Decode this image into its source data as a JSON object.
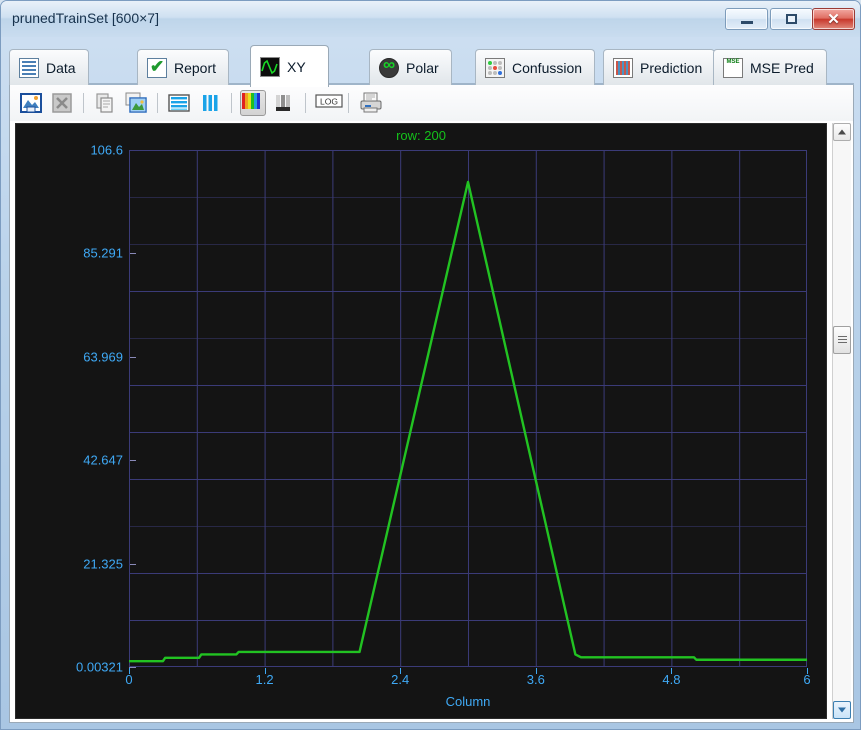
{
  "window": {
    "title": "prunedTrainSet [600×7]",
    "minimize_label": "Minimize",
    "maximize_label": "Restore",
    "close_label": "✕"
  },
  "tabs": [
    {
      "label": "Data",
      "icon": "table-icon",
      "active": false
    },
    {
      "label": "Report",
      "icon": "checkmark-icon",
      "active": false
    },
    {
      "label": "XY",
      "icon": "waveform-icon",
      "active": true
    },
    {
      "label": "Polar",
      "icon": "polar-icon",
      "active": false
    },
    {
      "label": "Confussion",
      "icon": "confusion-icon",
      "active": false
    },
    {
      "label": "Prediction",
      "icon": "prediction-icon",
      "active": false
    },
    {
      "label": "MSE Pred",
      "icon": "mse-icon",
      "active": false
    }
  ],
  "toolbar": {
    "buttons": [
      {
        "name": "save-image-button",
        "icon": "save-image-icon",
        "enabled": true,
        "pressed": false
      },
      {
        "name": "export-excel-button",
        "icon": "excel-icon",
        "enabled": false,
        "pressed": false
      },
      {
        "name": "copy-button",
        "icon": "copy-icon",
        "enabled": false,
        "pressed": false
      },
      {
        "name": "copy-image-button",
        "icon": "copy-image-icon",
        "enabled": true,
        "pressed": false
      },
      {
        "name": "horizontal-lines-button",
        "icon": "horizontal-lines-icon",
        "enabled": true,
        "pressed": false
      },
      {
        "name": "vertical-bars-button",
        "icon": "vertical-bars-icon",
        "enabled": true,
        "pressed": false
      },
      {
        "name": "color-palette-button",
        "icon": "color-palette-icon",
        "enabled": true,
        "pressed": true
      },
      {
        "name": "grayscale-button",
        "icon": "grayscale-bars-icon",
        "enabled": true,
        "pressed": false
      },
      {
        "name": "log-scale-button",
        "icon": "log-icon",
        "enabled": true,
        "pressed": false,
        "label": "LOG"
      },
      {
        "name": "print-button",
        "icon": "printer-icon",
        "enabled": true,
        "pressed": false
      }
    ]
  },
  "chart_data": {
    "type": "line",
    "title": "row: 200",
    "xlabel": "Column",
    "ylabel": "",
    "xlim": [
      0,
      6
    ],
    "ylim": [
      0.00321,
      106.6
    ],
    "grid": true,
    "legend": "none",
    "line_color": "#22c322",
    "axis_text_color": "#3fa9f5",
    "title_color": "#14c21b",
    "background_color": "#141414",
    "grid_color": "#3b3b78",
    "xticks": [
      "0",
      "1.2",
      "2.4",
      "3.6",
      "4.8",
      "6"
    ],
    "xtick_values": [
      0,
      1.2,
      2.4,
      3.6,
      4.8,
      6
    ],
    "yticks": [
      "0.00321",
      "21.325",
      "42.647",
      "63.969",
      "85.291",
      "106.6"
    ],
    "ytick_values": [
      0.00321,
      21.325,
      42.647,
      63.969,
      85.291,
      106.6
    ],
    "series": [
      {
        "name": "row 200",
        "x": [
          0.0,
          0.3,
          0.32,
          0.62,
          0.64,
          0.95,
          0.97,
          1.8,
          2.02,
          2.04,
          3.0,
          3.95,
          4.0,
          4.02,
          5.0,
          5.02,
          6.0
        ],
        "y": [
          1.2,
          1.2,
          1.9,
          1.9,
          2.6,
          2.6,
          3.1,
          3.1,
          3.1,
          3.1,
          100.0,
          2.6,
          2.0,
          2.0,
          2.0,
          1.5,
          1.5
        ]
      }
    ]
  },
  "scrollbar": {
    "up_label": "▲",
    "down_label": "▼",
    "thumb_label": "scroll-thumb"
  }
}
